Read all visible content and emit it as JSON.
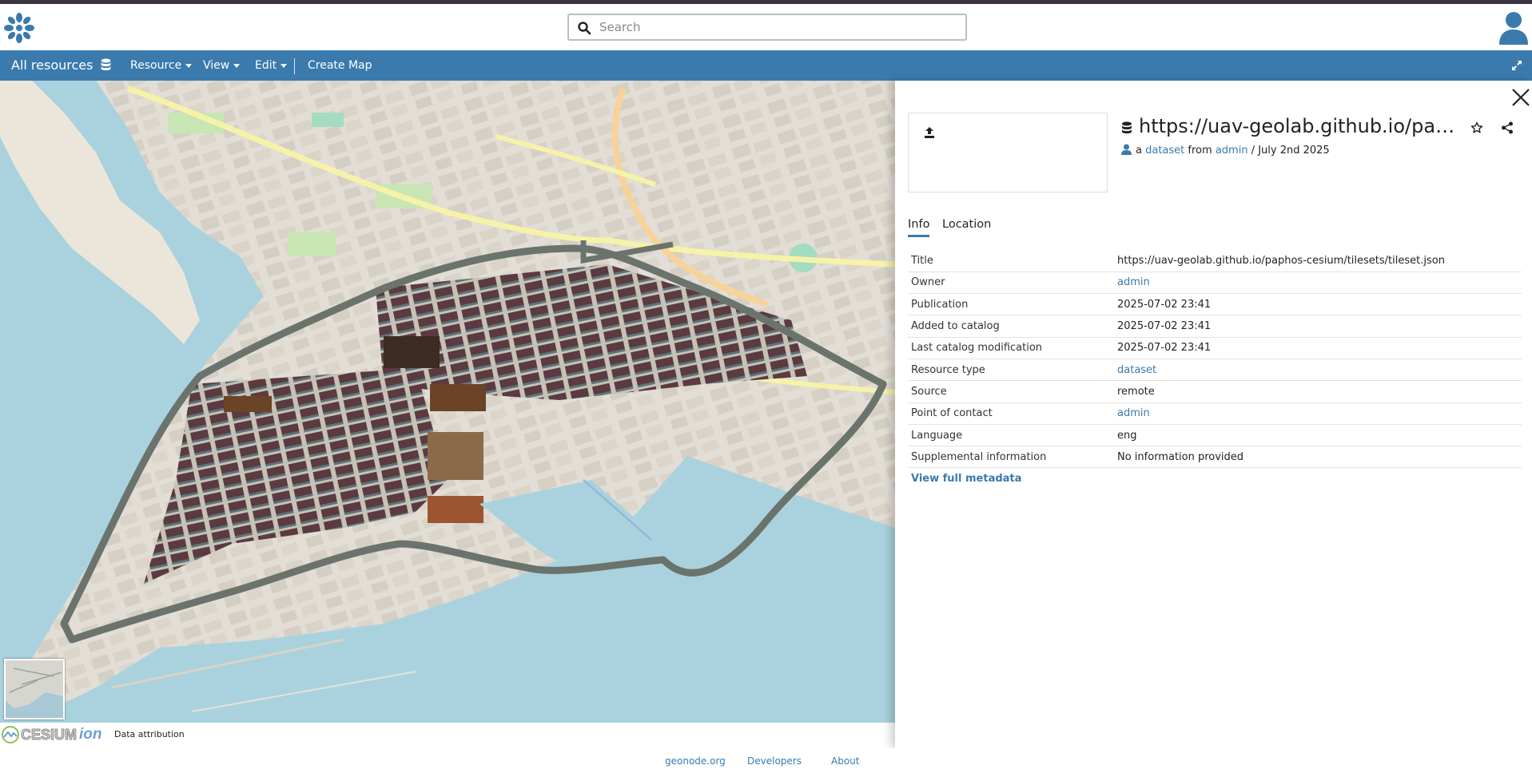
{
  "header": {
    "search_placeholder": "Search"
  },
  "menubar": {
    "brand": "All resources",
    "items": [
      {
        "label": "Resource"
      },
      {
        "label": "View"
      },
      {
        "label": "Edit"
      }
    ],
    "create_map": "Create Map"
  },
  "map": {
    "attribution": "Data attribution",
    "logo_text": "CESIUM",
    "logo_suffix": "ion"
  },
  "panel": {
    "title": "https://uav-geolab.github.io/paphos-cesium/tilesets/tileset.json",
    "byline": {
      "prefix": "a",
      "resource_type": "dataset",
      "from": "from",
      "owner": "admin",
      "date": "/ July 2nd 2025"
    },
    "tabs": [
      "Info",
      "Location"
    ],
    "rows": [
      {
        "key": "Title",
        "value": "https://uav-geolab.github.io/paphos-cesium/tilesets/tileset.json"
      },
      {
        "key": "Owner",
        "value": "admin"
      },
      {
        "key": "Publication",
        "value": "2025-07-02 23:41"
      },
      {
        "key": "Added to catalog",
        "value": "2025-07-02 23:41"
      },
      {
        "key": "Last catalog modification",
        "value": "2025-07-02 23:41"
      },
      {
        "key": "Resource type",
        "value": "dataset"
      },
      {
        "key": "Source",
        "value": "remote"
      },
      {
        "key": "Point of contact",
        "value": "admin"
      },
      {
        "key": "Language",
        "value": "eng"
      },
      {
        "key": "Supplemental information",
        "value": "No information provided"
      }
    ],
    "view_full_metadata": "View full metadata"
  },
  "footer": {
    "links": [
      "geonode.org",
      "Developers",
      "About"
    ]
  },
  "colors": {
    "primary": "#3a7aad",
    "top_strip": "#3c3340",
    "sea": "#a9d2de",
    "roofs": "#5b3a40",
    "walls": "#6f7a74"
  }
}
